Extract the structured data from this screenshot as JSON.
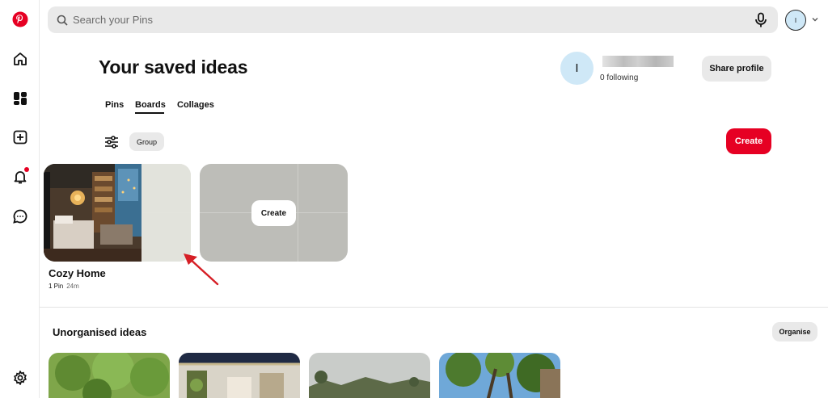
{
  "search": {
    "placeholder": "Search your Pins"
  },
  "header": {
    "title": "Your saved ideas",
    "avatar_initial": "I",
    "following": "0 following",
    "share_label": "Share profile"
  },
  "top_avatar_initial": "I",
  "tabs": [
    {
      "label": "Pins",
      "active": false
    },
    {
      "label": "Boards",
      "active": true
    },
    {
      "label": "Collages",
      "active": false
    }
  ],
  "toolbar": {
    "group_label": "Group",
    "create_label": "Create"
  },
  "boards": [
    {
      "title": "Cozy Home",
      "pins": "1 Pin",
      "age": "24m"
    }
  ],
  "create_card_label": "Create",
  "unorganised": {
    "title": "Unorganised ideas",
    "organise_label": "Organise"
  },
  "colors": {
    "brand_red": "#e60023",
    "chip_gray": "#e9e9e9",
    "avatar_blue": "#cfe8f7"
  },
  "icons": [
    "pinterest-logo-icon",
    "home-icon",
    "boards-icon",
    "create-icon",
    "bell-icon",
    "message-icon",
    "settings-icon",
    "search-icon",
    "microphone-icon",
    "chevron-down-icon",
    "filter-icon"
  ]
}
